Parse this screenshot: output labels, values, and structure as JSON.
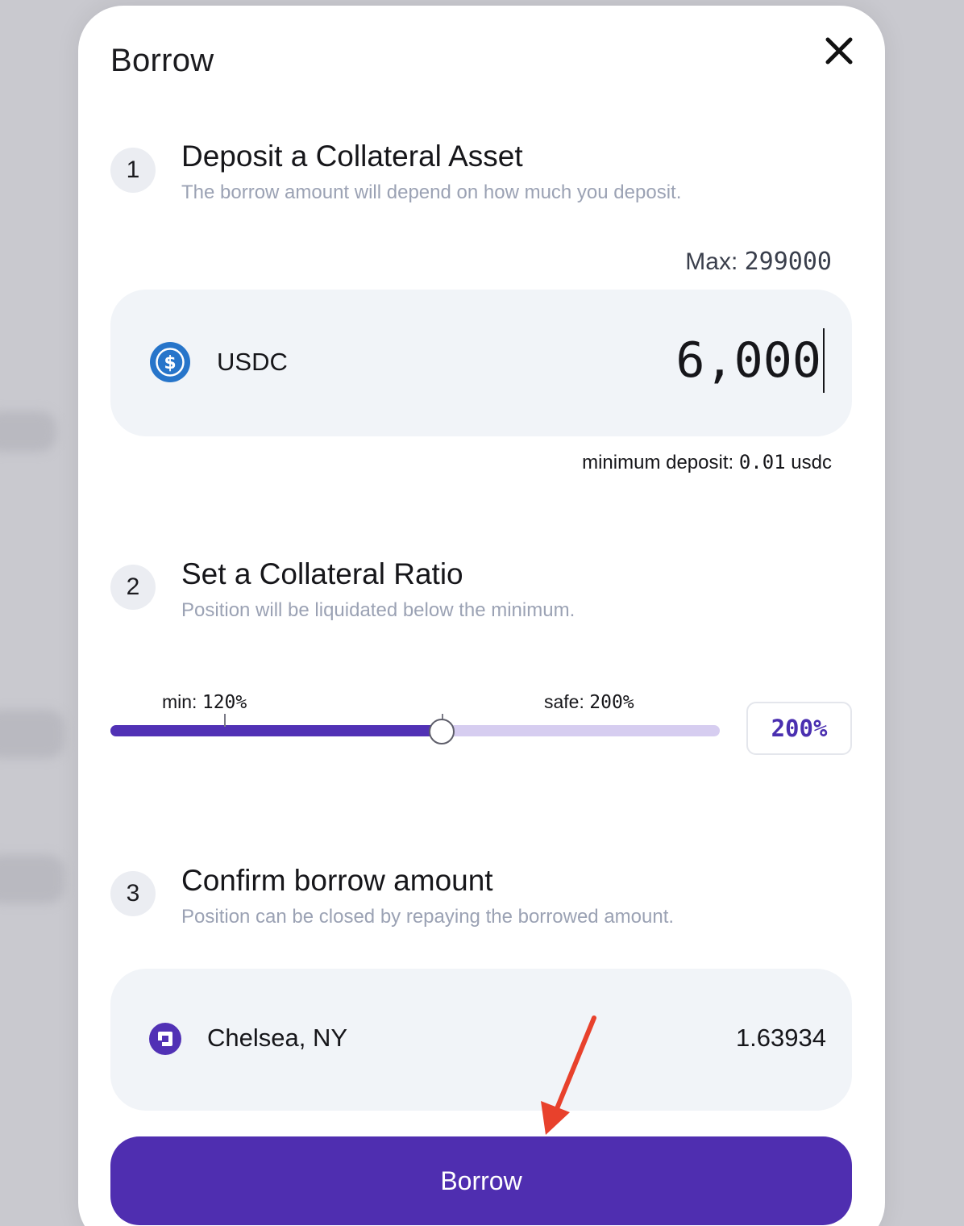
{
  "modal": {
    "title": "Borrow"
  },
  "steps": [
    {
      "number": "1",
      "title": "Deposit a Collateral Asset",
      "subtitle": "The borrow amount will depend on how much you deposit."
    },
    {
      "number": "2",
      "title": "Set a Collateral Ratio",
      "subtitle": "Position will be liquidated below the minimum."
    },
    {
      "number": "3",
      "title": "Confirm borrow amount",
      "subtitle": "Position can be closed by repaying the borrowed amount."
    }
  ],
  "deposit": {
    "max_label": "Max: ",
    "max_value": "299000",
    "asset": "USDC",
    "amount": "6,000",
    "min_deposit_prefix": "minimum deposit: ",
    "min_deposit_value": "0.01",
    "min_deposit_suffix": " usdc"
  },
  "ratio": {
    "min_label": "min: ",
    "min_value": "120%",
    "safe_label": "safe: ",
    "safe_value": "200%",
    "current": "200%",
    "slider_fraction": 0.544,
    "min_fraction": 0.186,
    "safe_fraction": 0.544
  },
  "confirm": {
    "asset": "Chelsea, NY",
    "amount": "1.63934"
  },
  "actions": {
    "borrow_label": "Borrow"
  },
  "colors": {
    "accent": "#4f2eb0",
    "usdc_blue": "#2775ca",
    "annotation_red": "#e8412c"
  }
}
